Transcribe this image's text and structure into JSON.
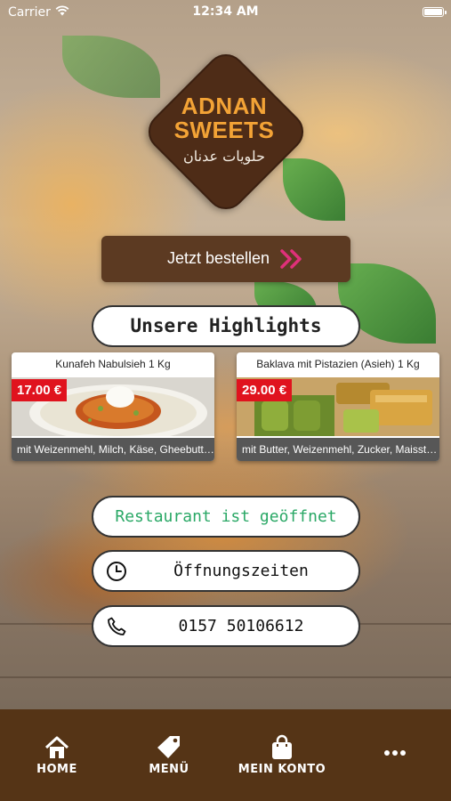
{
  "status_bar": {
    "carrier": "Carrier",
    "time": "12:34 AM"
  },
  "logo": {
    "line1": "ADNAN",
    "line2": "SWEETS",
    "arabic": "حلويات عدنان"
  },
  "order_button": {
    "label": "Jetzt bestellen",
    "icon": "double-chevron-right-icon"
  },
  "highlights": {
    "heading": "Unsere Highlights",
    "items": [
      {
        "title": "Kunafeh Nabulsieh 1 Kg",
        "price": "17.00 €",
        "description": "mit Weizenmehl, Milch, Käse, Gheebutter..."
      },
      {
        "title": "Baklava mit Pistazien (Asieh) 1 Kg",
        "price": "29.00 €",
        "description": "mit Butter, Weizenmehl, Zucker, Maisstärke..."
      }
    ]
  },
  "info_buttons": {
    "status": "Restaurant ist geöffnet",
    "hours": "Öffnungszeiten",
    "phone": "0157 50106612"
  },
  "tab_bar": {
    "home": "HOME",
    "menu": "MENÜ",
    "account": "MEIN KONTO",
    "more_icon": "more-dots-icon"
  },
  "colors": {
    "brand_brown": "#5c3a22",
    "tab_bar": "#553416",
    "logo_orange": "#f3a336",
    "price_red": "#e0131e",
    "open_green": "#2aa866"
  }
}
